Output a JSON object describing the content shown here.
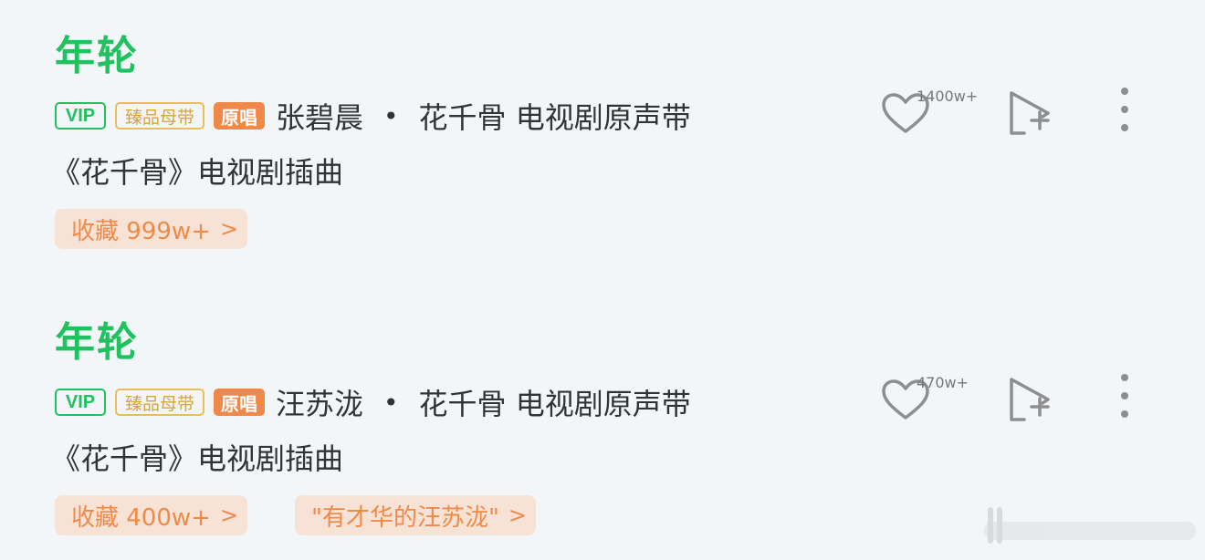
{
  "songs": [
    {
      "title": "年轮",
      "badges": {
        "vip": "VIP",
        "master": "臻品母带",
        "original": "原唱"
      },
      "artist": "张碧晨",
      "separator": "•",
      "album": "花千骨 电视剧原声带",
      "description": "《花千骨》电视剧插曲",
      "like_count": "1400w+",
      "tags": [
        {
          "text": "收藏 999w+",
          "chevron": ">"
        }
      ]
    },
    {
      "title": "年轮",
      "badges": {
        "vip": "VIP",
        "master": "臻品母带",
        "original": "原唱"
      },
      "artist": "汪苏泷",
      "separator": "•",
      "album": "花千骨 电视剧原声带",
      "description": "《花千骨》电视剧插曲",
      "like_count": "470w+",
      "tags": [
        {
          "text": "收藏 400w+",
          "chevron": ">"
        },
        {
          "text": "\"有才华的汪苏泷\"",
          "chevron": ">"
        }
      ]
    }
  ],
  "icons": {
    "like": "heart-outline-icon",
    "add": "add-to-playlist-icon",
    "more": "more-vertical-icon"
  },
  "colors": {
    "title": "#20c25f",
    "vip": "#20c25f",
    "master": "#d8a43c",
    "original_bg": "#f08849",
    "tag_bg": "#f7e3d6",
    "tag_text": "#ef8a48",
    "icon": "#8e8e8e",
    "background": "#f3f6f9"
  }
}
